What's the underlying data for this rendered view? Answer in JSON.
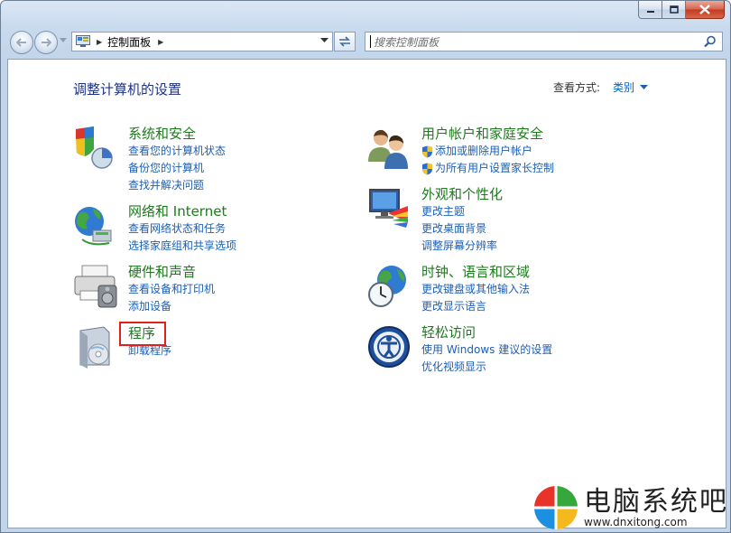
{
  "window": {
    "minimize_icon": "minimize-icon",
    "maximize_icon": "maximize-icon",
    "close_icon": "close-icon"
  },
  "address_bar": {
    "crumb": "控制面板",
    "search_placeholder": "搜索控制面板"
  },
  "header": {
    "title": "调整计算机的设置",
    "view_by_label": "查看方式:",
    "view_by_value": "类别"
  },
  "categories": [
    {
      "title": "系统和安全",
      "icon": "system-security-icon",
      "links": [
        "查看您的计算机状态",
        "备份您的计算机",
        "查找并解决问题"
      ]
    },
    {
      "title": "网络和 Internet",
      "icon": "network-internet-icon",
      "links": [
        "查看网络状态和任务",
        "选择家庭组和共享选项"
      ]
    },
    {
      "title": "硬件和声音",
      "icon": "hardware-sound-icon",
      "links": [
        "查看设备和打印机",
        "添加设备"
      ]
    },
    {
      "title": "程序",
      "icon": "programs-icon",
      "links": [
        "卸载程序"
      ]
    },
    {
      "title": "用户帐户和家庭安全",
      "icon": "user-accounts-icon",
      "links": [
        "添加或删除用户帐户",
        "为所有用户设置家长控制"
      ]
    },
    {
      "title": "外观和个性化",
      "icon": "appearance-icon",
      "links": [
        "更改主题",
        "更改桌面背景",
        "调整屏幕分辨率"
      ]
    },
    {
      "title": "时钟、语言和区域",
      "icon": "clock-language-icon",
      "links": [
        "更改键盘或其他输入法",
        "更改显示语言"
      ]
    },
    {
      "title": "轻松访问",
      "icon": "ease-of-access-icon",
      "links": [
        "使用 Windows 建议的设置",
        "优化视频显示"
      ]
    }
  ],
  "watermark": {
    "name": "电脑系统吧",
    "url": "www.dnxitong.com"
  },
  "colors": {
    "category_title": "#1d7a1d",
    "link": "#1c5fb5",
    "heading": "#1e3287",
    "highlight_box": "#e0201b"
  }
}
